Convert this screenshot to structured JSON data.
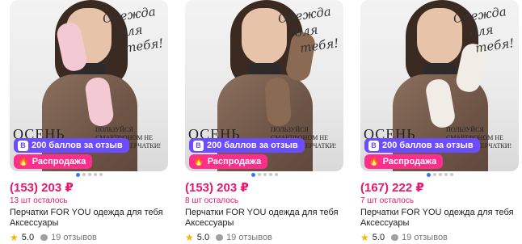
{
  "products": [
    {
      "script_lines": [
        "Одежда",
        "для",
        "тебя!"
      ],
      "autumn_text": "ОСЕНЬ",
      "promo_text": "ПОЛЬЗУЙСЯ СМАРТФОНОМ НЕ СНИМАЯ ПЕРЧАТКИ!",
      "points_badge": "200 баллов за отзыв",
      "sale_badge": "Распродажа",
      "price": "(153) 203 ₽",
      "stock": "13 шт осталось",
      "title_line1": "Перчатки FOR YOU одежда для тебя",
      "title_line2": "Аксессуары",
      "rating": "5.0",
      "reviews": "19 отзывов",
      "glove_color": "#f3c9d3"
    },
    {
      "script_lines": [
        "Одежда",
        "для",
        "тебя!"
      ],
      "autumn_text": "ОСЕНЬ",
      "promo_text": "ПОЛЬЗУЙСЯ СМАРТФОНОМ НЕ СНИМАЯ ПЕРЧАТКИ!",
      "points_badge": "200 баллов за отзыв",
      "sale_badge": "Распродажа",
      "price": "(153) 203 ₽",
      "stock": "8 шт осталось",
      "title_line1": "Перчатки FOR YOU одежда для тебя",
      "title_line2": "Аксессуары",
      "rating": "5.0",
      "reviews": "19 отзывов",
      "glove_color": "#8a6a52"
    },
    {
      "script_lines": [
        "Одежда",
        "для",
        "тебя!"
      ],
      "autumn_text": "ОСЕНЬ",
      "promo_text": "ПОЛЬЗУЙСЯ СМАРТФОНОМ НЕ СНИМАЯ ПЕРЧАТКИ!",
      "points_badge": "200 баллов за отзыв",
      "sale_badge": "Распродажа",
      "price": "(167) 222 ₽",
      "stock": "7 шт осталось",
      "title_line1": "Перчатки FOR YOU одежда для тебя",
      "title_line2": "Аксессуары",
      "rating": "5.0",
      "reviews": "19 отзывов",
      "glove_color": "#f1ede6"
    }
  ],
  "colors": {
    "price": "#e8186b",
    "points_badge": "#6b4dff",
    "sale_badge": "#ff2d8b",
    "carousel_active_dot": "#2f7cf6",
    "star": "#f5b400"
  },
  "icons": {
    "points_badge": "vk-icon",
    "sale_badge": "fire-icon",
    "rating": "star-icon",
    "reviews": "chat-bubble-icon"
  }
}
